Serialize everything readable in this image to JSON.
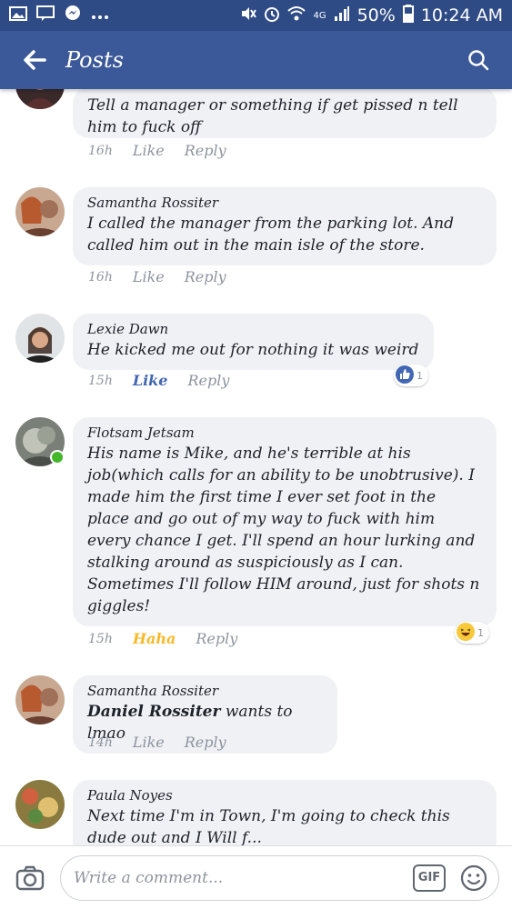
{
  "status_bar": {
    "left_icons": [
      "image-icon",
      "message-icon",
      "messenger-icon",
      "more-dots-icon"
    ],
    "right_icons": [
      "mute-icon",
      "alarm-icon",
      "wifi-icon",
      "signal-icon",
      "battery-icon"
    ],
    "battery": "50%",
    "time": "10:24 AM",
    "network": "4G"
  },
  "header": {
    "title": "Posts",
    "color": "#3b5998"
  },
  "comments": [
    {
      "author": "",
      "text": "Tell a manager or something if get pissed n tell him to fuck off",
      "time": "16h",
      "like": "Like",
      "reply": "Reply"
    },
    {
      "author": "Samantha Rossiter",
      "text": "I called the manager from the parking lot. And called him out in the main isle of the store.",
      "time": "16h",
      "like": "Like",
      "reply": "Reply"
    },
    {
      "author": "Lexie Dawn",
      "text": "He kicked me out for nothing it was weird",
      "time": "15h",
      "like": "Like",
      "reply": "Reply",
      "reaction": {
        "icon": "like-reaction-icon",
        "count": "1"
      }
    },
    {
      "author": "Flotsam Jetsam",
      "text": "His name is Mike, and he's terrible at his job(which calls for an ability to be unobtrusive). I made him the first time I ever set foot in the place and go out of my way to fuck with him every chance I get. I'll spend an hour lurking and stalking around as suspiciously as I can. Sometimes I'll follow HIM around, just for shots n giggles!",
      "time": "15h",
      "like": "Haha",
      "reply": "Reply",
      "reaction": {
        "icon": "haha-reaction-icon",
        "count": "1"
      }
    },
    {
      "author": "Samantha Rossiter",
      "mention": "Daniel Rossiter",
      "text": " wants to lmao",
      "time": "14h",
      "like": "Like",
      "reply": "Reply"
    },
    {
      "author": "Paula Noyes",
      "text": "Next time I'm in Town, I'm going to check this dude out and I Will f...",
      "time": "",
      "like": "",
      "reply": ""
    }
  ],
  "composer": {
    "placeholder": "Write a comment...",
    "gif_label": "GIF"
  }
}
